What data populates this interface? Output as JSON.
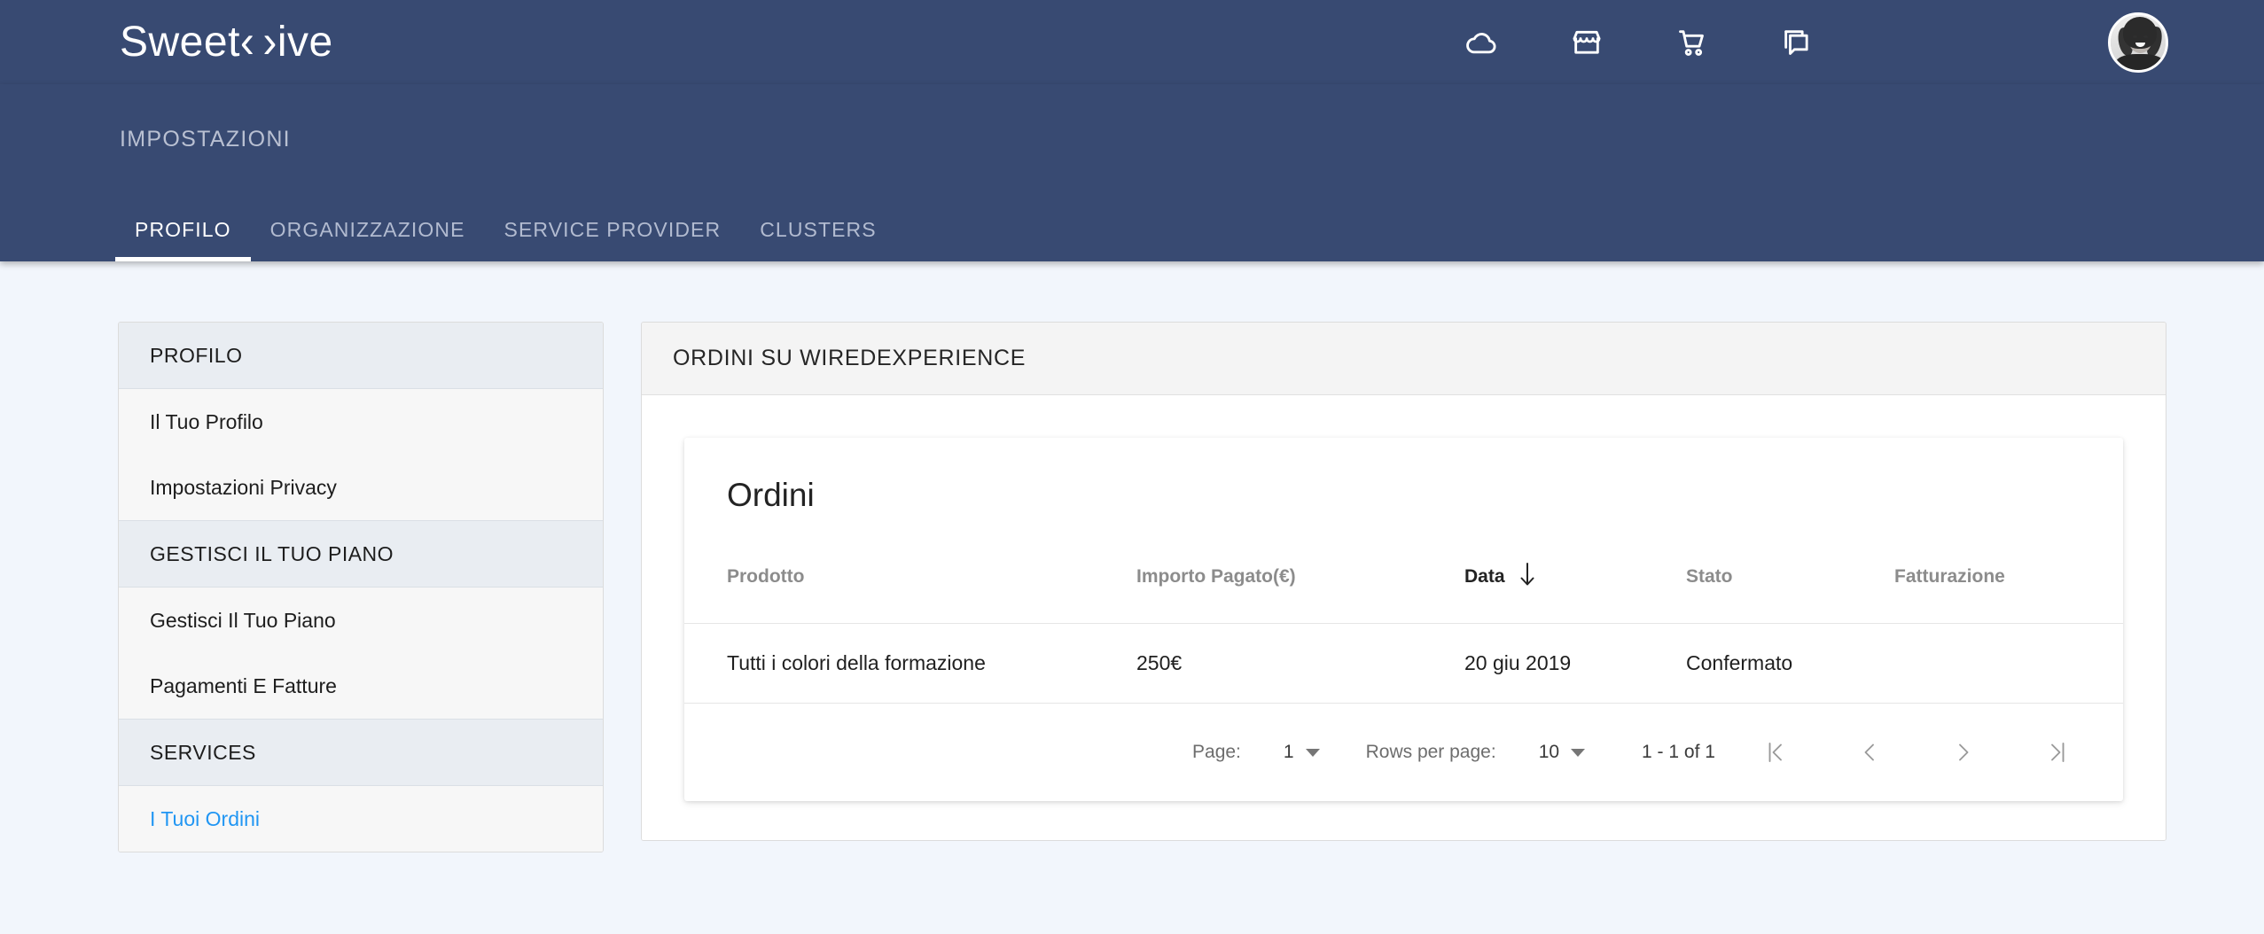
{
  "header": {
    "logo_part1": "Sweet",
    "logo_bracket_left": "‹",
    "logo_bracket_right": "›",
    "logo_part2": "ive",
    "icons": [
      {
        "name": "cloud-icon",
        "label": "cloud"
      },
      {
        "name": "storefront-icon",
        "label": "storefront"
      },
      {
        "name": "shopping-cart-icon",
        "label": "cart"
      },
      {
        "name": "chat-bubbles-icon",
        "label": "messages"
      }
    ],
    "avatar_label": "user-avatar"
  },
  "subnav": {
    "title": "IMPOSTAZIONI",
    "tabs": [
      {
        "label": "PROFILO",
        "active": true
      },
      {
        "label": "ORGANIZZAZIONE",
        "active": false
      },
      {
        "label": "SERVICE PROVIDER",
        "active": false
      },
      {
        "label": "CLUSTERS",
        "active": false
      }
    ]
  },
  "sidebar": {
    "groups": [
      {
        "header": "PROFILO",
        "items": [
          {
            "label": "Il Tuo Profilo",
            "active": false
          },
          {
            "label": "Impostazioni Privacy",
            "active": false
          }
        ]
      },
      {
        "header": "GESTISCI IL TUO PIANO",
        "items": [
          {
            "label": "Gestisci Il Tuo Piano",
            "active": false
          },
          {
            "label": "Pagamenti E Fatture",
            "active": false
          }
        ]
      },
      {
        "header": "SERVICES",
        "items": [
          {
            "label": "I Tuoi Ordini",
            "active": true
          }
        ]
      }
    ]
  },
  "main": {
    "panel_title": "ORDINI SU WIREDEXPERIENCE",
    "table_title": "Ordini",
    "columns": [
      {
        "label": "Prodotto",
        "sorted": false
      },
      {
        "label": "Importo Pagato(€)",
        "sorted": false
      },
      {
        "label": "Data",
        "sorted": true,
        "sort_direction": "desc"
      },
      {
        "label": "Stato",
        "sorted": false
      },
      {
        "label": "Fatturazione",
        "sorted": false
      }
    ],
    "rows": [
      {
        "prodotto": "Tutti i colori della formazione",
        "importo": "250€",
        "data": "20 giu 2019",
        "stato": "Confermato",
        "fatturazione": ""
      }
    ],
    "pagination": {
      "page_label": "Page:",
      "page_value": "1",
      "rows_label": "Rows per page:",
      "rows_value": "10",
      "range": "1 - 1 of 1",
      "first_label": "first-page",
      "prev_label": "previous-page",
      "next_label": "next-page",
      "last_label": "last-page"
    }
  },
  "colors": {
    "header_blue": "#384a72",
    "page_background": "#f2f6fc",
    "accent_link": "#2196f3",
    "section_gray": "#e9edf2"
  }
}
